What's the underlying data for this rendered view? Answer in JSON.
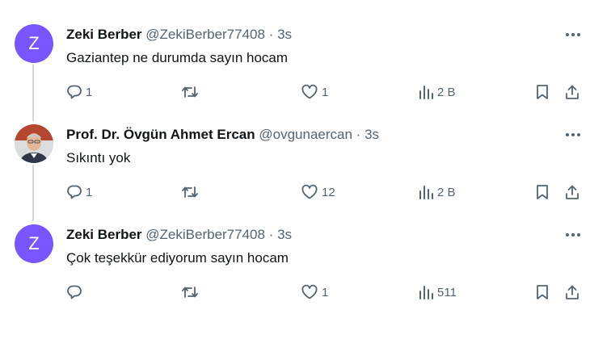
{
  "tweets": [
    {
      "avatar_letter": "Z",
      "avatar_color": "#7856ff",
      "name": "Zeki Berber",
      "handle": "@ZekiBerber77408",
      "separator": "·",
      "time": "3s",
      "text": "Gaziantep ne durumda sayın hocam",
      "replies": "1",
      "retweets": "",
      "likes": "1",
      "views": "2 B"
    },
    {
      "avatar_letter": "",
      "avatar_color": "#e7e9ea",
      "name": "Prof. Dr. Övgün Ahmet Ercan",
      "handle": "@ovgunaercan",
      "separator": "·",
      "time": "3s",
      "text": "Sıkıntı yok",
      "replies": "1",
      "retweets": "",
      "likes": "12",
      "views": "2 B"
    },
    {
      "avatar_letter": "Z",
      "avatar_color": "#7856ff",
      "name": "Zeki Berber",
      "handle": "@ZekiBerber77408",
      "separator": "·",
      "time": "3s",
      "text": "Çok teşekkür ediyorum sayın hocam",
      "replies": "",
      "retweets": "",
      "likes": "1",
      "views": "511"
    }
  ],
  "icons": {
    "reply": "reply-icon",
    "retweet": "retweet-icon",
    "like": "heart-icon",
    "views": "views-icon",
    "bookmark": "bookmark-icon",
    "share": "share-icon",
    "more": "more-icon"
  },
  "colors": {
    "text_primary": "#0f1419",
    "text_secondary": "#536471",
    "thread_line": "#cfd9de",
    "avatar_purple": "#7856ff"
  }
}
